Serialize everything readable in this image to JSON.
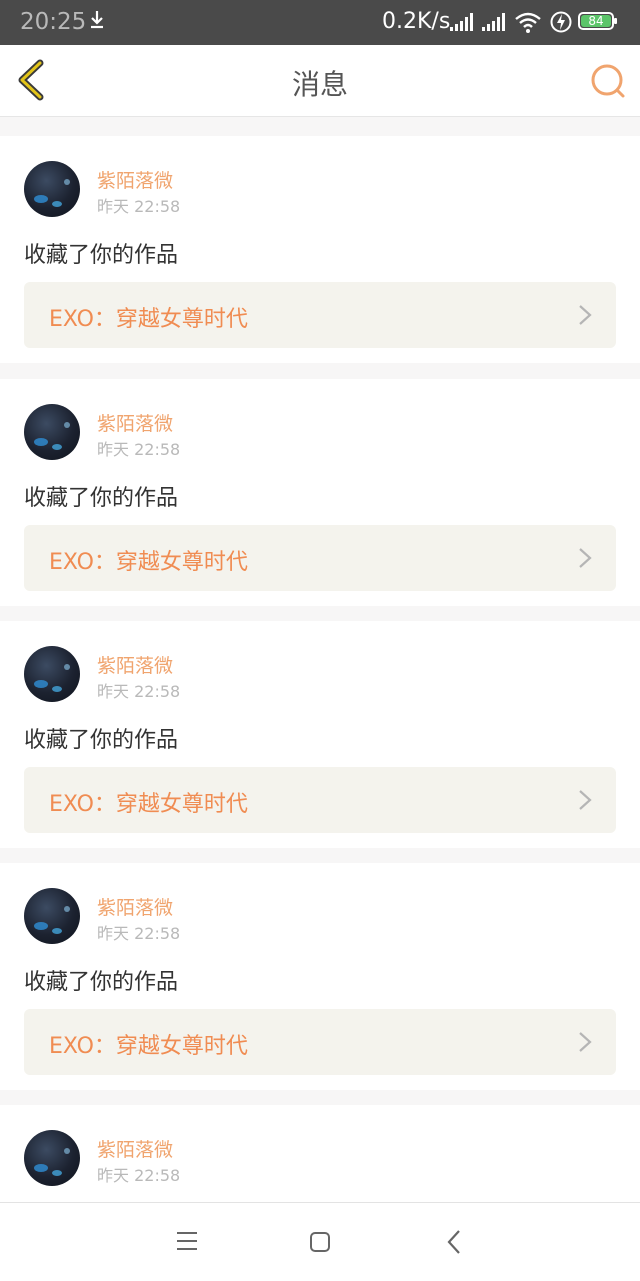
{
  "status_bar": {
    "time": "20:25",
    "network_speed": "0.2K/s",
    "battery_level": "84",
    "icons": [
      "download-icon",
      "signal-icon",
      "signal-icon",
      "wifi-icon",
      "charging-icon",
      "battery-icon"
    ]
  },
  "header": {
    "title": "消息",
    "back_icon": "back-chevron-icon",
    "search_icon": "search-icon"
  },
  "messages": [
    {
      "user": "紫陌落微",
      "time": "昨天 22:58",
      "action": "收藏了你的作品",
      "work": "EXO：穿越女尊时代"
    },
    {
      "user": "紫陌落微",
      "time": "昨天 22:58",
      "action": "收藏了你的作品",
      "work": "EXO：穿越女尊时代"
    },
    {
      "user": "紫陌落微",
      "time": "昨天 22:58",
      "action": "收藏了你的作品",
      "work": "EXO：穿越女尊时代"
    },
    {
      "user": "紫陌落微",
      "time": "昨天 22:58",
      "action": "收藏了你的作品",
      "work": "EXO：穿越女尊时代"
    },
    {
      "user": "紫陌落微",
      "time": "昨天 22:58"
    }
  ],
  "nav_bar": {
    "buttons": [
      "menu-icon",
      "home-icon",
      "back-icon"
    ]
  },
  "colors": {
    "accent": "#f08c52",
    "username": "#f0a46e",
    "work_bg": "#f4f3ed",
    "status_bar_bg": "#4a4a4a",
    "back_arrow": "#e0c020"
  }
}
